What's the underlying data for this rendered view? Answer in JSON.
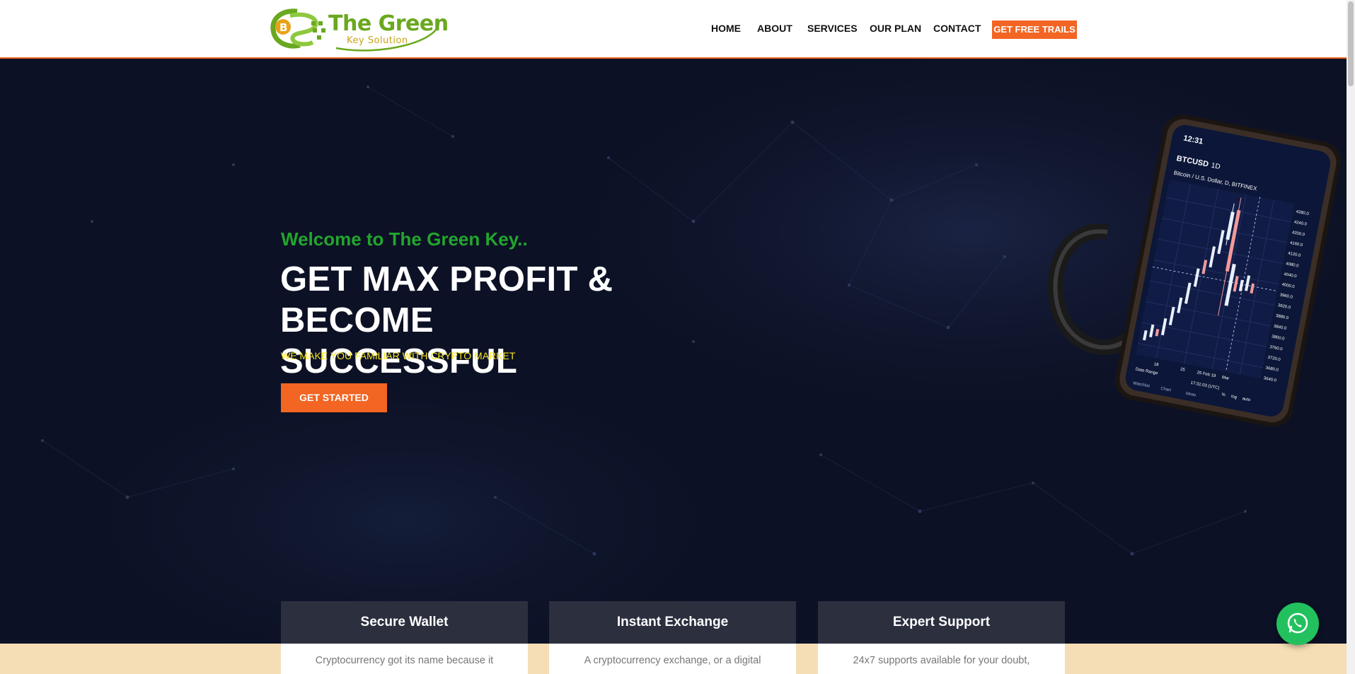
{
  "header": {
    "logo": {
      "line1": "The Green",
      "line2": "Key Solution",
      "coin_letter": "B"
    },
    "nav": [
      {
        "label": "HOME"
      },
      {
        "label": "ABOUT"
      },
      {
        "label": "SERVICES"
      },
      {
        "label": "OUR PLAN"
      },
      {
        "label": "CONTACT"
      }
    ],
    "cta_label": "GET FREE TRAILS"
  },
  "hero": {
    "welcome": "Welcome to The Green Key..",
    "headline_line1": "GET MAX PROFIT & BECOME",
    "headline_line2": "SUCCESSFUL",
    "subline": "WE MAKE YOU FAMILIAR WITH CRYPTO MARKET",
    "button_label": "GET STARTED",
    "phone": {
      "time": "12:31",
      "symbol": "BTCUSD",
      "interval": "1D",
      "pair": "Bitcoin / U.S. Dollar, D, BITFINEX",
      "price_labels": [
        "4280.0",
        "4240.0",
        "4200.0",
        "4160.0",
        "4120.0",
        "4080.0",
        "4040.0",
        "4000.0",
        "3960.0",
        "3920.0",
        "3880.0",
        "3840.0",
        "3800.0",
        "3760.0",
        "3720.0",
        "3680.0",
        "3640.0"
      ],
      "date_labels": [
        "18",
        "25",
        "25 Feb 19",
        "Mar"
      ],
      "date_range": "Date Range",
      "utc": "17:31:03 (UTC)",
      "tabs": [
        "Watchlist",
        "Chart",
        "Ideas"
      ],
      "toggles": [
        "%",
        "log",
        "auto"
      ]
    }
  },
  "cards": [
    {
      "title": "Secure Wallet",
      "text": "Cryptocurrency got its name because it"
    },
    {
      "title": "Instant Exchange",
      "text": "A cryptocurrency exchange, or a digital"
    },
    {
      "title": "Expert Support",
      "text": "24x7 supports available for your doubt,"
    }
  ],
  "colors": {
    "accent": "#f26522",
    "hero_bg": "#0c1125",
    "welcome_green": "#22a52e",
    "subline_yellow": "#f5e31d",
    "card_head": "#2b2f3e",
    "band": "#f5deb5",
    "whatsapp": "#22c15e"
  },
  "icons": {
    "whatsapp": "whatsapp-icon"
  }
}
